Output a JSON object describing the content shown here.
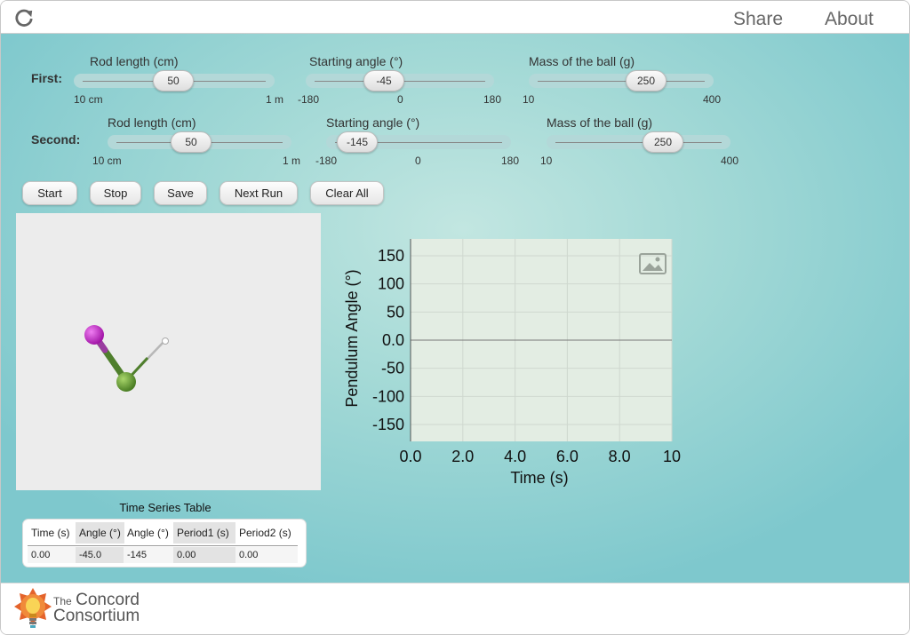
{
  "header": {
    "reload_icon": "reload-icon",
    "share_label": "Share",
    "about_label": "About"
  },
  "controls": {
    "rows": [
      {
        "label": "First:",
        "sliders": [
          {
            "label": "Rod length (cm)",
            "value": "50",
            "min_label": "10 cm",
            "max_label": "1 m",
            "fraction": 0.444
          },
          {
            "label": "Starting angle (°)",
            "value": "-45",
            "min_label": "-180",
            "mid_label": "0",
            "max_label": "180",
            "fraction": 0.375
          },
          {
            "label": "Mass of the ball (g)",
            "value": "250",
            "min_label": "10",
            "max_label": "400",
            "fraction": 0.615
          }
        ]
      },
      {
        "label": "Second:",
        "sliders": [
          {
            "label": "Rod length (cm)",
            "value": "50",
            "min_label": "10 cm",
            "max_label": "1 m",
            "fraction": 0.444
          },
          {
            "label": "Starting angle (°)",
            "value": "-145",
            "min_label": "-180",
            "mid_label": "0",
            "max_label": "180",
            "fraction": 0.097
          },
          {
            "label": "Mass of the ball (g)",
            "value": "250",
            "min_label": "10",
            "max_label": "400",
            "fraction": 0.615
          }
        ]
      }
    ]
  },
  "buttons": {
    "start": "Start",
    "stop": "Stop",
    "save": "Save",
    "next_run": "Next Run",
    "clear_all": "Clear All"
  },
  "pendulum": {
    "first_ball_color": "#7bb33a",
    "second_ball_color": "#c02cc6",
    "rod_color": "#4f7f2c"
  },
  "chart_data": {
    "type": "line",
    "xlabel": "Time (s)",
    "ylabel": "Pendulum Angle (°)",
    "xlim": [
      0,
      10
    ],
    "ylim": [
      -180,
      180
    ],
    "xticks": [
      "0.0",
      "2.0",
      "4.0",
      "6.0",
      "8.0",
      "10"
    ],
    "yticks": [
      "150",
      "100",
      "50",
      "0.0",
      "-50",
      "-100",
      "-150"
    ],
    "grid": true,
    "series": [],
    "snapshot_icon": "image-icon"
  },
  "table": {
    "title": "Time Series Table",
    "headers": [
      "Time (s)",
      "Angle (°)",
      "Angle (°)",
      "Period1 (s)",
      "Period2 (s)"
    ],
    "rows": [
      [
        "0.00",
        "-45.0",
        "-145",
        "0.00",
        "0.00"
      ]
    ]
  },
  "footer": {
    "logo_the": "The",
    "logo_concord": "Concord",
    "logo_consortium": "Consortium"
  }
}
